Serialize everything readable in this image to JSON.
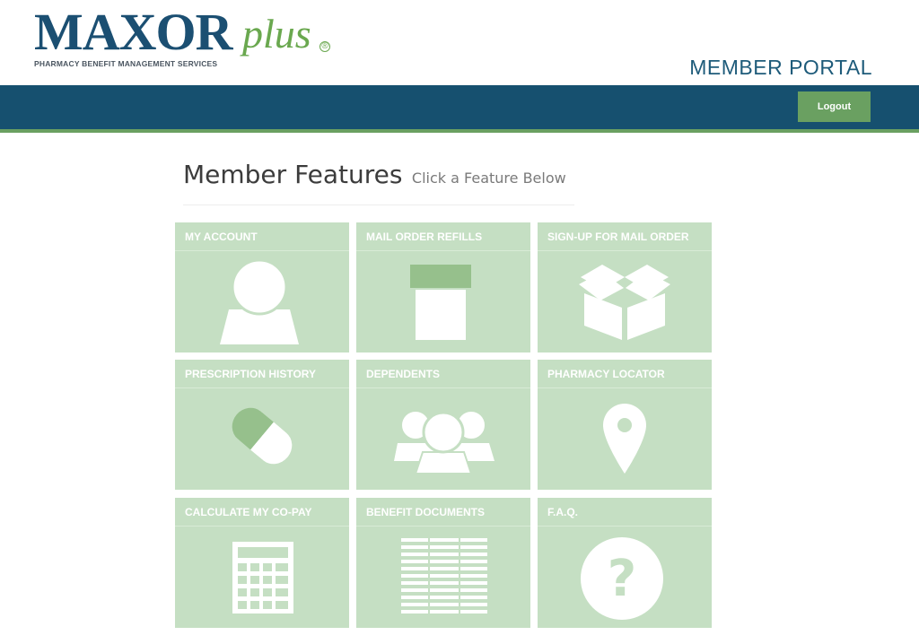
{
  "header": {
    "logo": {
      "main": "MAXOR",
      "plus": "plus",
      "reg": "®",
      "tagline": "PHARMACY BENEFIT MANAGEMENT SERVICES"
    },
    "portal_title": "MEMBER PORTAL",
    "logout_label": "Logout"
  },
  "colors": {
    "navbar": "#16506f",
    "accent_green": "#6aa061",
    "tile_bg": "#c5dfc3",
    "tile_icon": "#ffffff",
    "brand_blue": "#1b4f72"
  },
  "features": {
    "title": "Member Features",
    "subtitle": "Click a Feature Below",
    "tiles": [
      {
        "label": "MY ACCOUNT",
        "icon": "person-icon"
      },
      {
        "label": "MAIL ORDER REFILLS",
        "icon": "pill-bottle-icon"
      },
      {
        "label": "SIGN-UP FOR MAIL ORDER",
        "icon": "open-box-icon"
      },
      {
        "label": "PRESCRIPTION HISTORY",
        "icon": "capsule-icon"
      },
      {
        "label": "DEPENDENTS",
        "icon": "group-icon"
      },
      {
        "label": "PHARMACY LOCATOR",
        "icon": "map-pin-icon"
      },
      {
        "label": "CALCULATE MY CO-PAY",
        "icon": "calculator-icon"
      },
      {
        "label": "BENEFIT DOCUMENTS",
        "icon": "document-table-icon"
      },
      {
        "label": "F.A.Q.",
        "icon": "question-mark-icon"
      }
    ]
  }
}
